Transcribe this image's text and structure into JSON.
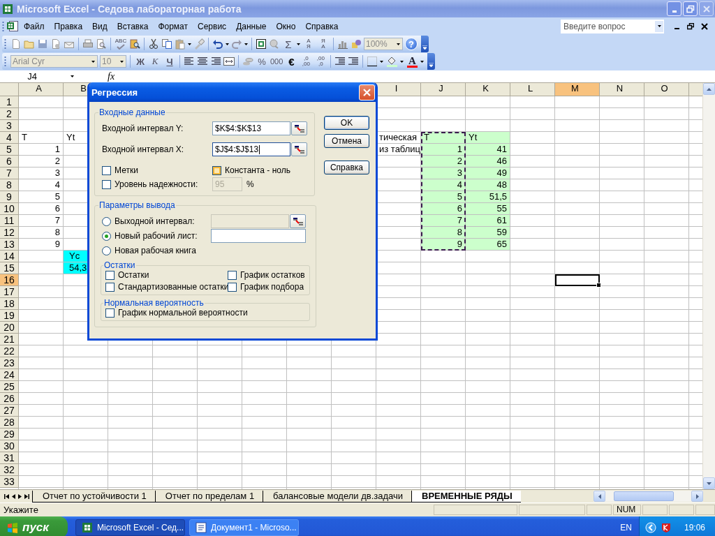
{
  "window": {
    "title": "Microsoft Excel - Седова лабораторная работа"
  },
  "menu": [
    "Файл",
    "Правка",
    "Вид",
    "Вставка",
    "Формат",
    "Сервис",
    "Данные",
    "Окно",
    "Справка"
  ],
  "help_box": {
    "placeholder": "Введите вопрос"
  },
  "standard_toolbar": {
    "spelling": "ABC",
    "autosum": "Σ",
    "sort_buttons": [
      {
        "top": "А",
        "bottom": "Я"
      },
      {
        "top": "Я",
        "bottom": "А"
      }
    ],
    "zoom": "100%",
    "help": "?"
  },
  "formatting_toolbar": {
    "font": "Arial Cyr",
    "size": "10",
    "styles": [
      "Ж",
      "К",
      "Ч"
    ],
    "number_formats": [
      "%",
      "000",
      "€"
    ],
    "decimal_buttons": [
      {
        "top": ",0",
        "bottom": ",00"
      },
      {
        "top": ",00",
        "bottom": ",0"
      }
    ],
    "font_color": "A"
  },
  "formula_bar": {
    "name_box": "J4",
    "function_label": "fx"
  },
  "sheet": {
    "columns": [
      {
        "kind": "header",
        "label": "A",
        "selected": false
      },
      {
        "kind": "header",
        "label": "B",
        "selected": false
      },
      {
        "kind": "covered"
      },
      {
        "kind": "covered"
      },
      {
        "kind": "covered"
      },
      {
        "kind": "covered"
      },
      {
        "kind": "covered"
      },
      {
        "kind": "covered"
      },
      {
        "kind": "header",
        "label": "I",
        "selected": false
      },
      {
        "kind": "header",
        "label": "J",
        "selected": false
      },
      {
        "kind": "header",
        "label": "K",
        "selected": false
      },
      {
        "kind": "header",
        "label": "L",
        "selected": false
      },
      {
        "kind": "header",
        "label": "M",
        "selected": true
      },
      {
        "kind": "header",
        "label": "N",
        "selected": false
      },
      {
        "kind": "header",
        "label": "O",
        "selected": false
      }
    ],
    "rows": [
      {
        "label": "1",
        "selected": false
      },
      {
        "label": "2",
        "selected": false
      },
      {
        "label": "3",
        "selected": false
      },
      {
        "label": "4",
        "selected": false,
        "cells": [
          {
            "kind": "text",
            "text": "T",
            "color": "#ffffff",
            "copied": false
          },
          {
            "kind": "text",
            "text": "Yt",
            "color": "#ffffff",
            "copied": false
          },
          {
            "kind": "blank"
          },
          {
            "kind": "blank"
          },
          {
            "kind": "blank"
          },
          {
            "kind": "blank"
          },
          {
            "kind": "blank"
          },
          {
            "kind": "blank"
          },
          {
            "kind": "text",
            "text": "тическая",
            "color": "#ffffff",
            "copied": false
          },
          {
            "kind": "text",
            "text": "T",
            "color": "#ccffcc",
            "copied": true
          },
          {
            "kind": "text",
            "text": "Yt",
            "color": "#ccffcc",
            "copied": false
          }
        ]
      },
      {
        "label": "5",
        "selected": false,
        "cells": [
          {
            "kind": "number",
            "text": "1",
            "color": "#ffffff",
            "copied": false
          },
          {
            "kind": "blank"
          },
          {
            "kind": "blank"
          },
          {
            "kind": "blank"
          },
          {
            "kind": "blank"
          },
          {
            "kind": "blank"
          },
          {
            "kind": "blank"
          },
          {
            "kind": "blank"
          },
          {
            "kind": "text",
            "text": "из таблиц",
            "color": "#ffffff",
            "copied": false
          },
          {
            "kind": "number",
            "text": "1",
            "color": "#ccffcc",
            "copied": true
          },
          {
            "kind": "number",
            "text": "41",
            "color": "#ccffcc",
            "copied": false
          }
        ]
      },
      {
        "label": "6",
        "selected": false,
        "cells": [
          {
            "kind": "number",
            "text": "2",
            "color": "#ffffff",
            "copied": false
          },
          {
            "kind": "blank"
          },
          {
            "kind": "blank"
          },
          {
            "kind": "blank"
          },
          {
            "kind": "blank"
          },
          {
            "kind": "blank"
          },
          {
            "kind": "blank"
          },
          {
            "kind": "blank"
          },
          {
            "kind": "blank"
          },
          {
            "kind": "number",
            "text": "2",
            "color": "#ccffcc",
            "copied": true
          },
          {
            "kind": "number",
            "text": "46",
            "color": "#ccffcc",
            "copied": false
          }
        ]
      },
      {
        "label": "7",
        "selected": false,
        "cells": [
          {
            "kind": "number",
            "text": "3",
            "color": "#ffffff",
            "copied": false
          },
          {
            "kind": "blank"
          },
          {
            "kind": "blank"
          },
          {
            "kind": "blank"
          },
          {
            "kind": "blank"
          },
          {
            "kind": "blank"
          },
          {
            "kind": "blank"
          },
          {
            "kind": "blank"
          },
          {
            "kind": "blank"
          },
          {
            "kind": "number",
            "text": "3",
            "color": "#ccffcc",
            "copied": true
          },
          {
            "kind": "number",
            "text": "49",
            "color": "#ccffcc",
            "copied": false
          }
        ]
      },
      {
        "label": "8",
        "selected": false,
        "cells": [
          {
            "kind": "number",
            "text": "4",
            "color": "#ffffff",
            "copied": false
          },
          {
            "kind": "blank"
          },
          {
            "kind": "blank"
          },
          {
            "kind": "blank"
          },
          {
            "kind": "blank"
          },
          {
            "kind": "blank"
          },
          {
            "kind": "blank"
          },
          {
            "kind": "blank"
          },
          {
            "kind": "blank"
          },
          {
            "kind": "number",
            "text": "4",
            "color": "#ccffcc",
            "copied": true
          },
          {
            "kind": "number",
            "text": "48",
            "color": "#ccffcc",
            "copied": false
          }
        ]
      },
      {
        "label": "9",
        "selected": false,
        "cells": [
          {
            "kind": "number",
            "text": "5",
            "color": "#ffffff",
            "copied": false
          },
          {
            "kind": "blank"
          },
          {
            "kind": "blank"
          },
          {
            "kind": "blank"
          },
          {
            "kind": "blank"
          },
          {
            "kind": "blank"
          },
          {
            "kind": "blank"
          },
          {
            "kind": "blank"
          },
          {
            "kind": "blank"
          },
          {
            "kind": "number",
            "text": "5",
            "color": "#ccffcc",
            "copied": true
          },
          {
            "kind": "number",
            "text": "51,5",
            "color": "#ccffcc",
            "copied": false
          }
        ]
      },
      {
        "label": "10",
        "selected": false,
        "cells": [
          {
            "kind": "number",
            "text": "6",
            "color": "#ffffff",
            "copied": false
          },
          {
            "kind": "blank"
          },
          {
            "kind": "blank"
          },
          {
            "kind": "blank"
          },
          {
            "kind": "blank"
          },
          {
            "kind": "blank"
          },
          {
            "kind": "blank"
          },
          {
            "kind": "blank"
          },
          {
            "kind": "blank"
          },
          {
            "kind": "number",
            "text": "6",
            "color": "#ccffcc",
            "copied": true
          },
          {
            "kind": "number",
            "text": "55",
            "color": "#ccffcc",
            "copied": false
          }
        ]
      },
      {
        "label": "11",
        "selected": false,
        "cells": [
          {
            "kind": "number",
            "text": "7",
            "color": "#ffffff",
            "copied": false
          },
          {
            "kind": "blank"
          },
          {
            "kind": "blank"
          },
          {
            "kind": "blank"
          },
          {
            "kind": "blank"
          },
          {
            "kind": "blank"
          },
          {
            "kind": "blank"
          },
          {
            "kind": "blank"
          },
          {
            "kind": "blank"
          },
          {
            "kind": "number",
            "text": "7",
            "color": "#ccffcc",
            "copied": true
          },
          {
            "kind": "number",
            "text": "61",
            "color": "#ccffcc",
            "copied": false
          }
        ]
      },
      {
        "label": "12",
        "selected": false,
        "cells": [
          {
            "kind": "number",
            "text": "8",
            "color": "#ffffff",
            "copied": false
          },
          {
            "kind": "blank"
          },
          {
            "kind": "blank"
          },
          {
            "kind": "blank"
          },
          {
            "kind": "blank"
          },
          {
            "kind": "blank"
          },
          {
            "kind": "blank"
          },
          {
            "kind": "blank"
          },
          {
            "kind": "blank"
          },
          {
            "kind": "number",
            "text": "8",
            "color": "#ccffcc",
            "copied": true
          },
          {
            "kind": "number",
            "text": "59",
            "color": "#ccffcc",
            "copied": false
          }
        ]
      },
      {
        "label": "13",
        "selected": false,
        "cells": [
          {
            "kind": "number",
            "text": "9",
            "color": "#ffffff",
            "copied": false
          },
          {
            "kind": "blank"
          },
          {
            "kind": "blank"
          },
          {
            "kind": "blank"
          },
          {
            "kind": "blank"
          },
          {
            "kind": "blank"
          },
          {
            "kind": "blank"
          },
          {
            "kind": "blank"
          },
          {
            "kind": "blank"
          },
          {
            "kind": "number",
            "text": "9",
            "color": "#ccffcc",
            "copied": true
          },
          {
            "kind": "number",
            "text": "65",
            "color": "#ccffcc",
            "copied": false
          }
        ]
      },
      {
        "label": "14",
        "selected": false,
        "cells": [
          {
            "kind": "blank"
          },
          {
            "kind": "text",
            "text": "Yc",
            "color": "#00ffff",
            "copied": false
          }
        ]
      },
      {
        "label": "15",
        "selected": false,
        "cells": [
          {
            "kind": "blank"
          },
          {
            "kind": "text",
            "text": "54,3",
            "color": "#00ffff",
            "copied": false
          }
        ]
      },
      {
        "label": "16",
        "selected": true
      },
      {
        "label": "17",
        "selected": false
      },
      {
        "label": "18",
        "selected": false
      },
      {
        "label": "19",
        "selected": false
      },
      {
        "label": "20",
        "selected": false
      },
      {
        "label": "21",
        "selected": false
      },
      {
        "label": "22",
        "selected": false
      },
      {
        "label": "23",
        "selected": false
      },
      {
        "label": "24",
        "selected": false
      },
      {
        "label": "25",
        "selected": false
      },
      {
        "label": "26",
        "selected": false
      },
      {
        "label": "27",
        "selected": false
      },
      {
        "label": "28",
        "selected": false
      },
      {
        "label": "29",
        "selected": false
      },
      {
        "label": "30",
        "selected": false
      },
      {
        "label": "31",
        "selected": false
      },
      {
        "label": "32",
        "selected": false
      },
      {
        "label": "33",
        "selected": false
      }
    ]
  },
  "dialog": {
    "title": "Регрессия",
    "input_group": {
      "title": "Входные данные",
      "fields": [
        {
          "label": "Входной интервал Y:",
          "value": "$K$4:$K$13",
          "focused": false
        },
        {
          "label": "Входной интервал X:",
          "value": "$J$4:$J$13",
          "focused": true
        }
      ],
      "checkboxes": [
        {
          "label": "Метки",
          "checked": false,
          "hovered": false
        },
        {
          "label": "Константа - ноль",
          "checked": false,
          "hovered": true
        }
      ],
      "confidence": {
        "label": "Уровень надежности:",
        "checked": false,
        "hovered": false,
        "value": "95",
        "unit": "%"
      }
    },
    "output_group": {
      "title": "Параметры вывода",
      "options": [
        {
          "label": "Выходной интервал:",
          "selected": false,
          "kind": "range"
        },
        {
          "label": "Новый рабочий лист:",
          "selected": true,
          "kind": "text"
        },
        {
          "label": "Новая рабочая книга",
          "selected": false,
          "kind": "none"
        }
      ],
      "residuals": {
        "title": "Остатки",
        "checkboxes": [
          {
            "label": "Остатки",
            "checked": false,
            "hovered": false
          },
          {
            "label": "График остатков",
            "checked": false,
            "hovered": false
          },
          {
            "label": "Стандартизованные остатки",
            "checked": false,
            "hovered": false
          },
          {
            "label": "График подбора",
            "checked": false,
            "hovered": false
          }
        ]
      },
      "normal": {
        "title": "Нормальная вероятность",
        "checkboxes": [
          {
            "label": "График нормальной вероятности",
            "checked": false,
            "hovered": false
          }
        ]
      }
    },
    "buttons": [
      {
        "label": "OK",
        "default": true
      },
      {
        "label": "Отмена",
        "default": false
      },
      {
        "label": "Справка",
        "default": false
      }
    ]
  },
  "sheet_tabs": [
    {
      "label": "Отчет по устойчивости 1",
      "selected": false
    },
    {
      "label": "Отчет по пределам 1",
      "selected": false
    },
    {
      "label": "балансовые модели дв.задачи",
      "selected": false
    },
    {
      "label": "ВРЕМЕННЫЕ РЯДЫ",
      "selected": true
    }
  ],
  "status_bar": {
    "message": "Укажите",
    "indicator": "NUM"
  },
  "taskbar": {
    "start": "пуск",
    "tasks": [
      {
        "label": "Microsoft Excel - Сед...",
        "selected": true,
        "kind": "sheet"
      },
      {
        "label": "Документ1 - Microso...",
        "selected": false,
        "kind": "document"
      }
    ],
    "language": "EN",
    "clock": "19:06"
  }
}
